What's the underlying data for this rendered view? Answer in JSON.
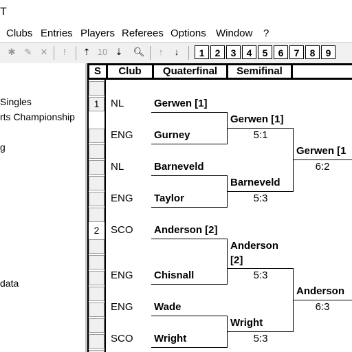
{
  "window": {
    "title": "T"
  },
  "menu": [
    "Clubs",
    "Entries",
    "Players",
    "Referees",
    "Options",
    "Window",
    "?"
  ],
  "toolbar": {
    "number_buttons": [
      "1",
      "2",
      "3",
      "4",
      "5",
      "6",
      "7",
      "8",
      "9"
    ],
    "ten_label": "10"
  },
  "tree": [
    "Singles",
    "rts Championship",
    "g",
    "data"
  ],
  "grid": {
    "headers": {
      "seed": "S",
      "club": "Club",
      "quarterfinal": "Quaterfinal",
      "semifinal": "Semifinal"
    },
    "rows": [
      {
        "seed": "1",
        "club": "NL",
        "player": "Gerwen [1]"
      },
      {
        "seed": "",
        "club": "ENG",
        "player": "Gurney"
      },
      {
        "seed": "",
        "club": "NL",
        "player": "Barneveld"
      },
      {
        "seed": "",
        "club": "ENG",
        "player": "Taylor"
      },
      {
        "seed": "2",
        "club": "SCO",
        "player": "Anderson [2]"
      },
      {
        "seed": "",
        "club": "ENG",
        "player": "Chisnall"
      },
      {
        "seed": "",
        "club": "ENG",
        "player": "Wade"
      },
      {
        "seed": "",
        "club": "SCO",
        "player": "Wright"
      }
    ],
    "quarterfinal_winners": [
      {
        "name": "Gerwen [1]",
        "score": "5:1"
      },
      {
        "name": "Barneveld",
        "score": "5:3"
      },
      {
        "name_line1": "Anderson",
        "name_line2": "[2]",
        "score": "5:3"
      },
      {
        "name": "Wright",
        "score": "5:3"
      }
    ],
    "semifinal_winners": [
      {
        "name": "Gerwen [1",
        "score": "6:2"
      },
      {
        "name": "Anderson",
        "score": "6:3"
      }
    ]
  }
}
